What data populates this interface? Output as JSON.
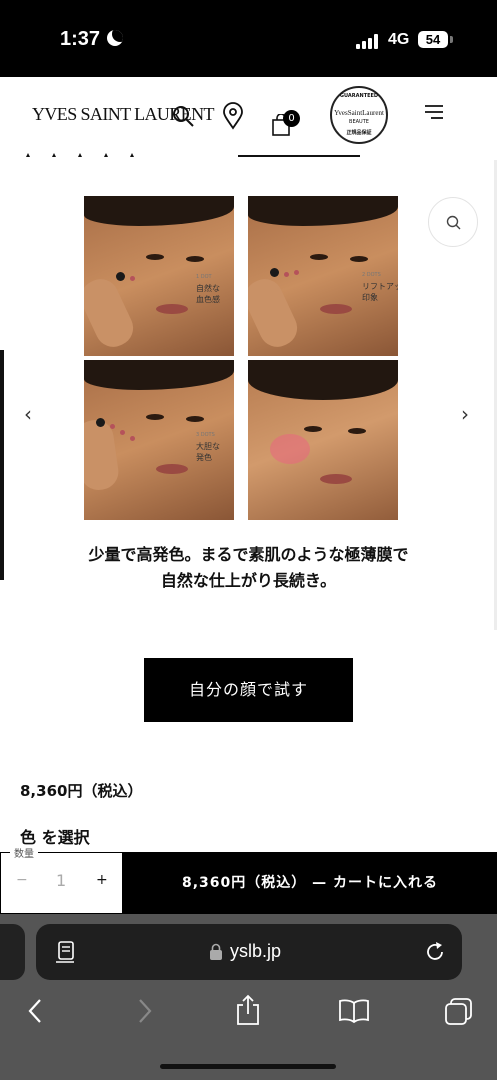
{
  "status_bar": {
    "time": "1:37",
    "network": "4G",
    "battery": "54"
  },
  "header": {
    "logo": "YVES SAINT LAURENT",
    "cart_count": "0",
    "seal": {
      "top": "GUARANTEED",
      "brand": "YvesSaintLaurent",
      "sub": "BEAUTE",
      "bottom": "正規品保証"
    }
  },
  "product": {
    "image": {
      "captions": [
        {
          "small": "1 DOT",
          "text": "自然な\n血色感"
        },
        {
          "small": "2 DOTS",
          "text": "リフトアップ\n印象"
        },
        {
          "small": "3 DOTS",
          "text": "大胆な\n発色"
        }
      ]
    },
    "caption_line1": "少量で高発色。まるで素肌のような極薄膜で",
    "caption_line2": "自然な仕上がり長続き。",
    "try_button": "自分の顔で試す",
    "price": "8,360円（税込）",
    "color_select": "色 を選択"
  },
  "purchase_bar": {
    "qty_label": "数量",
    "qty_minus": "−",
    "qty_value": "1",
    "qty_plus": "+",
    "cart_text": "8,360円（税込） — カートに入れる"
  },
  "browser": {
    "url": "yslb.jp"
  },
  "colors": {
    "accent": "#000000",
    "blush": "#e86680",
    "background": "#ffffff"
  },
  "icons": [
    "search-icon",
    "location-pin-icon",
    "shopping-bag-icon",
    "hamburger-menu-icon",
    "zoom-icon",
    "chevron-left-icon",
    "chevron-right-icon",
    "lock-icon",
    "reload-icon",
    "share-icon",
    "bookmarks-icon",
    "tabs-icon"
  ]
}
